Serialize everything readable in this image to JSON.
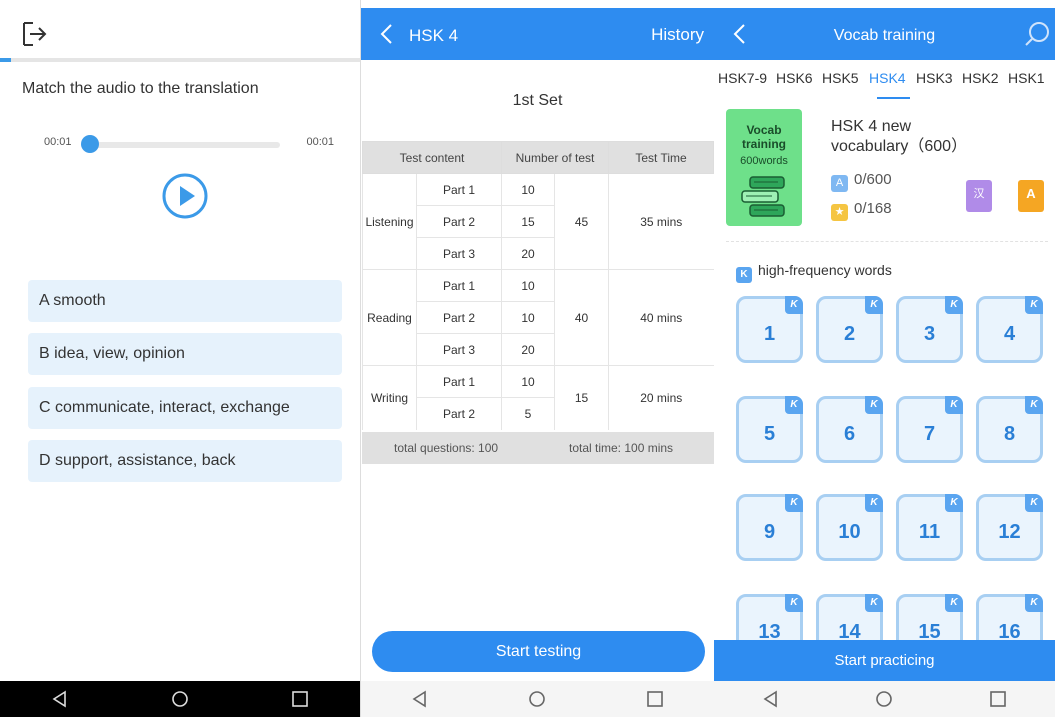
{
  "panel_quiz": {
    "instruction": "Match the audio to the translation",
    "progress_fraction": 0.03,
    "audio": {
      "time_start": "00:01",
      "time_end": "00:01",
      "position_fraction": 0.0
    },
    "options": [
      {
        "label": "A smooth"
      },
      {
        "label": "B idea, view, opinion"
      },
      {
        "label": "C communicate, interact, exchange"
      },
      {
        "label": "D support, assistance, back"
      }
    ],
    "icons": {
      "exit": "exit-icon",
      "play": "play-icon"
    }
  },
  "panel_exam": {
    "header": {
      "title": "HSK 4",
      "history_label": "History"
    },
    "set_title": "1st Set",
    "table": {
      "headers": [
        "Test content",
        "Number of test",
        "Test Time"
      ],
      "sections": [
        {
          "name": "Listening",
          "parts": [
            {
              "part": "Part 1",
              "count": "10"
            },
            {
              "part": "Part 2",
              "count": "15"
            },
            {
              "part": "Part 3",
              "count": "20"
            }
          ],
          "total": "45",
          "time": "35 mins"
        },
        {
          "name": "Reading",
          "parts": [
            {
              "part": "Part 1",
              "count": "10"
            },
            {
              "part": "Part 2",
              "count": "10"
            },
            {
              "part": "Part 3",
              "count": "20"
            }
          ],
          "total": "40",
          "time": "40 mins"
        },
        {
          "name": "Writing",
          "parts": [
            {
              "part": "Part 1",
              "count": "10"
            },
            {
              "part": "Part 2",
              "count": "5"
            }
          ],
          "total": "15",
          "time": "20 mins"
        }
      ],
      "footer_questions": "total questions: 100",
      "footer_time": "total time: 100 mins"
    },
    "start_button": "Start testing"
  },
  "panel_vocab": {
    "header": {
      "title": "Vocab training"
    },
    "levels": [
      "HSK7-9",
      "HSK6",
      "HSK5",
      "HSK4",
      "HSK3",
      "HSK2",
      "HSK1"
    ],
    "active_level": "HSK4",
    "card": {
      "title": "Vocab training",
      "subtitle": "600words"
    },
    "vocab_title_line1": "HSK 4 new",
    "vocab_title_line2": "vocabulary（600）",
    "stat_a": {
      "badge": "A",
      "value": "0/600"
    },
    "stat_star": {
      "badge": "★",
      "value": "0/168"
    },
    "book_buttons": [
      {
        "label": "汉",
        "color": "#b08be8"
      },
      {
        "label": "A",
        "color": "#f5a623"
      }
    ],
    "hf_badge": "K",
    "hf_label": "high-frequency words",
    "tiles": [
      "1",
      "2",
      "3",
      "4",
      "5",
      "6",
      "7",
      "8",
      "9",
      "10",
      "11",
      "12",
      "13",
      "14",
      "15",
      "16"
    ],
    "tile_badge": "K",
    "start_button": "Start practicing"
  },
  "colors": {
    "accent": "#2e8cf0",
    "option_bg": "#e6f2fc",
    "card_green": "#6ee08a"
  }
}
